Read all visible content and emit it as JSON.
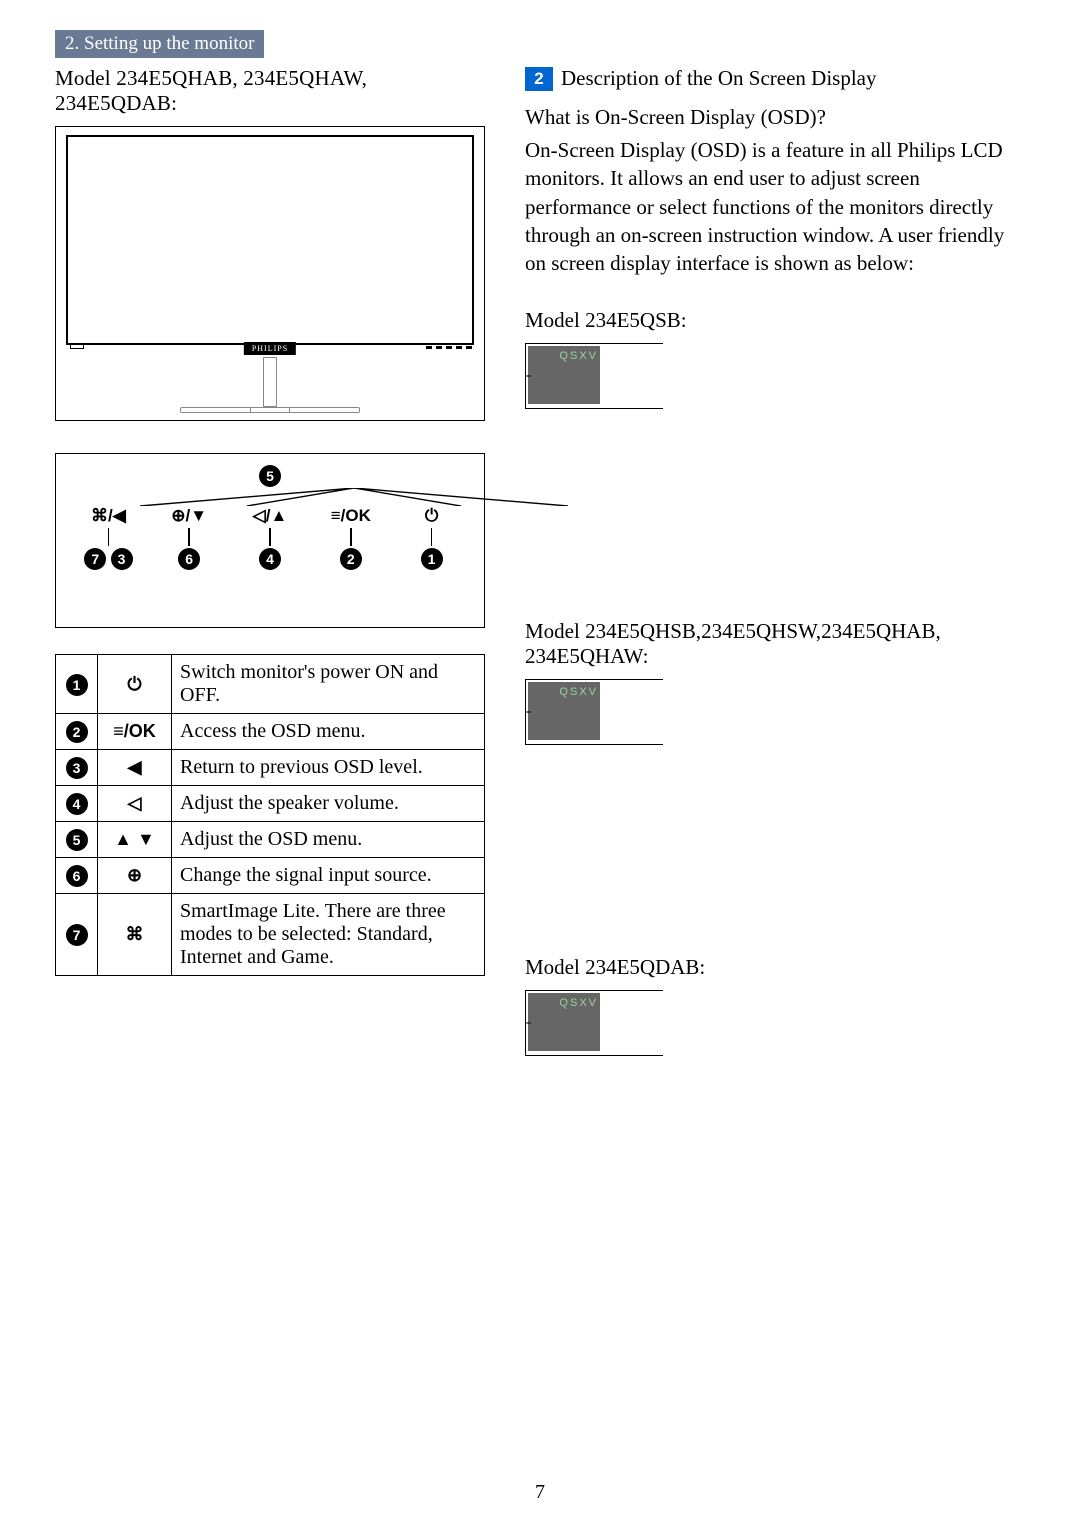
{
  "section_header": "2. Setting up the monitor",
  "left": {
    "model_title": "Model 234E5QHAB, 234E5QHAW, 234E5QDAB:",
    "monitor_brand": "PHILIPS",
    "button_map": {
      "top_num": "5",
      "row_labels": [
        "⌘/◀",
        "⊕/▼",
        "◁/▲",
        "≡/OK",
        "⏻"
      ],
      "bottom_nums": [
        [
          "7",
          "3"
        ],
        [
          "6"
        ],
        [
          "4"
        ],
        [
          "2"
        ],
        [
          "1"
        ]
      ]
    },
    "table_rows": [
      {
        "num": "1",
        "icon": "⏻",
        "desc": "Switch monitor's power ON and OFF."
      },
      {
        "num": "2",
        "icon": "≡/OK",
        "desc": "Access the OSD menu."
      },
      {
        "num": "3",
        "icon": "◀",
        "desc": "Return to previous OSD level."
      },
      {
        "num": "4",
        "icon": "◁",
        "desc": "Adjust the speaker volume."
      },
      {
        "num": "5",
        "icon": "▲ ▼",
        "desc": "Adjust the OSD menu."
      },
      {
        "num": "6",
        "icon": "⊕",
        "desc": "Change the signal input source."
      },
      {
        "num": "7",
        "icon": "⌘",
        "desc": "SmartImage Lite. There are three modes to be selected: Standard, Internet and Game."
      }
    ]
  },
  "right": {
    "step_num": "2",
    "step_title": "Description of the On Screen Display",
    "q_head": "What is On-Screen Display (OSD)?",
    "q_body": "On-Screen Display (OSD) is a feature in all Philips LCD monitors. It allows an end user to adjust screen performance or select functions of the monitors directly through an on-screen instruction window. A user friendly on screen display interface is shown as below:",
    "models": [
      {
        "title": "Model 234E5QSB:",
        "thumb_text": "QSXV"
      },
      {
        "title": "Model 234E5QHSB,234E5QHSW,234E5QHAB, 234E5QHAW:",
        "thumb_text": "QSXV"
      },
      {
        "title": "Model 234E5QDAB:",
        "thumb_text": "QSXV"
      }
    ]
  },
  "page_number": "7"
}
